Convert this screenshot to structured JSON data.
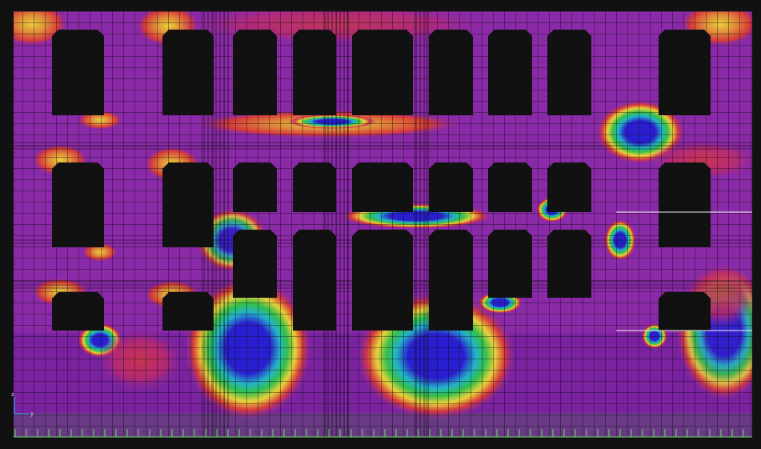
{
  "viewport": {
    "background": "#111111",
    "mesh_color": "#0a0a0a",
    "support_color": "#66dd66",
    "contour_colors": {
      "base": "#8a2aa8",
      "low": "#2a1fd0",
      "mid_low": "#22b4c8",
      "mid": "#34c04a",
      "mid_high": "#e8d23a",
      "high": "#d83a3a",
      "max": "#c81e6e"
    }
  },
  "axes": {
    "z_label": "z",
    "y_label": "y",
    "icon": "axis-triad-icon"
  }
}
